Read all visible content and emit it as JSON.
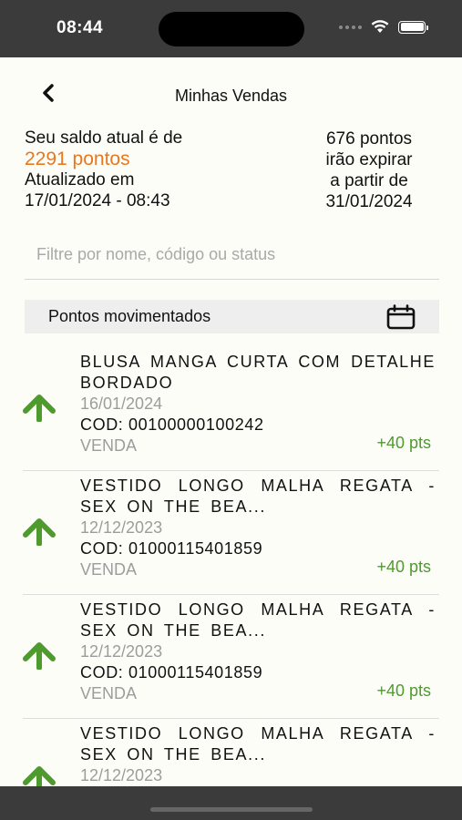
{
  "status_bar": {
    "time": "08:44"
  },
  "header": {
    "title": "Minhas Vendas"
  },
  "balance": {
    "label": "Seu saldo atual é de",
    "points": "2291 pontos",
    "updated_label": "Atualizado em",
    "updated_at": "17/01/2024 - 08:43"
  },
  "expiring": {
    "line1": "676 pontos",
    "line2": "irão expirar",
    "line3": "a partir de",
    "line4": "31/01/2024"
  },
  "filter": {
    "placeholder": "Filtre por nome, código ou status",
    "value": ""
  },
  "section": {
    "title": "Pontos movimentados"
  },
  "colors": {
    "accent_orange": "#e8781f",
    "positive_green": "#4e9a2f",
    "muted_gray": "#9c9c9c"
  },
  "icons": {
    "back": "chevron-left-icon",
    "calendar": "calendar-icon",
    "arrow": "arrow-up-icon"
  },
  "items": [
    {
      "name": "BLUSA MANGA CURTA COM DETALHE BORDADO",
      "date": "16/01/2024",
      "code": "COD: 00100000100242",
      "type": "VENDA",
      "points": "+40 pts"
    },
    {
      "name": "VESTIDO LONGO MALHA REGATA - SEX ON THE BEA...",
      "date": "12/12/2023",
      "code": "COD: 01000115401859",
      "type": "VENDA",
      "points": "+40 pts"
    },
    {
      "name": "VESTIDO LONGO MALHA REGATA - SEX ON THE BEA...",
      "date": "12/12/2023",
      "code": "COD: 01000115401859",
      "type": "VENDA",
      "points": "+40 pts"
    },
    {
      "name": "VESTIDO LONGO MALHA REGATA - SEX ON THE BEA...",
      "date": "12/12/2023",
      "code": "",
      "type": "",
      "points": ""
    }
  ]
}
